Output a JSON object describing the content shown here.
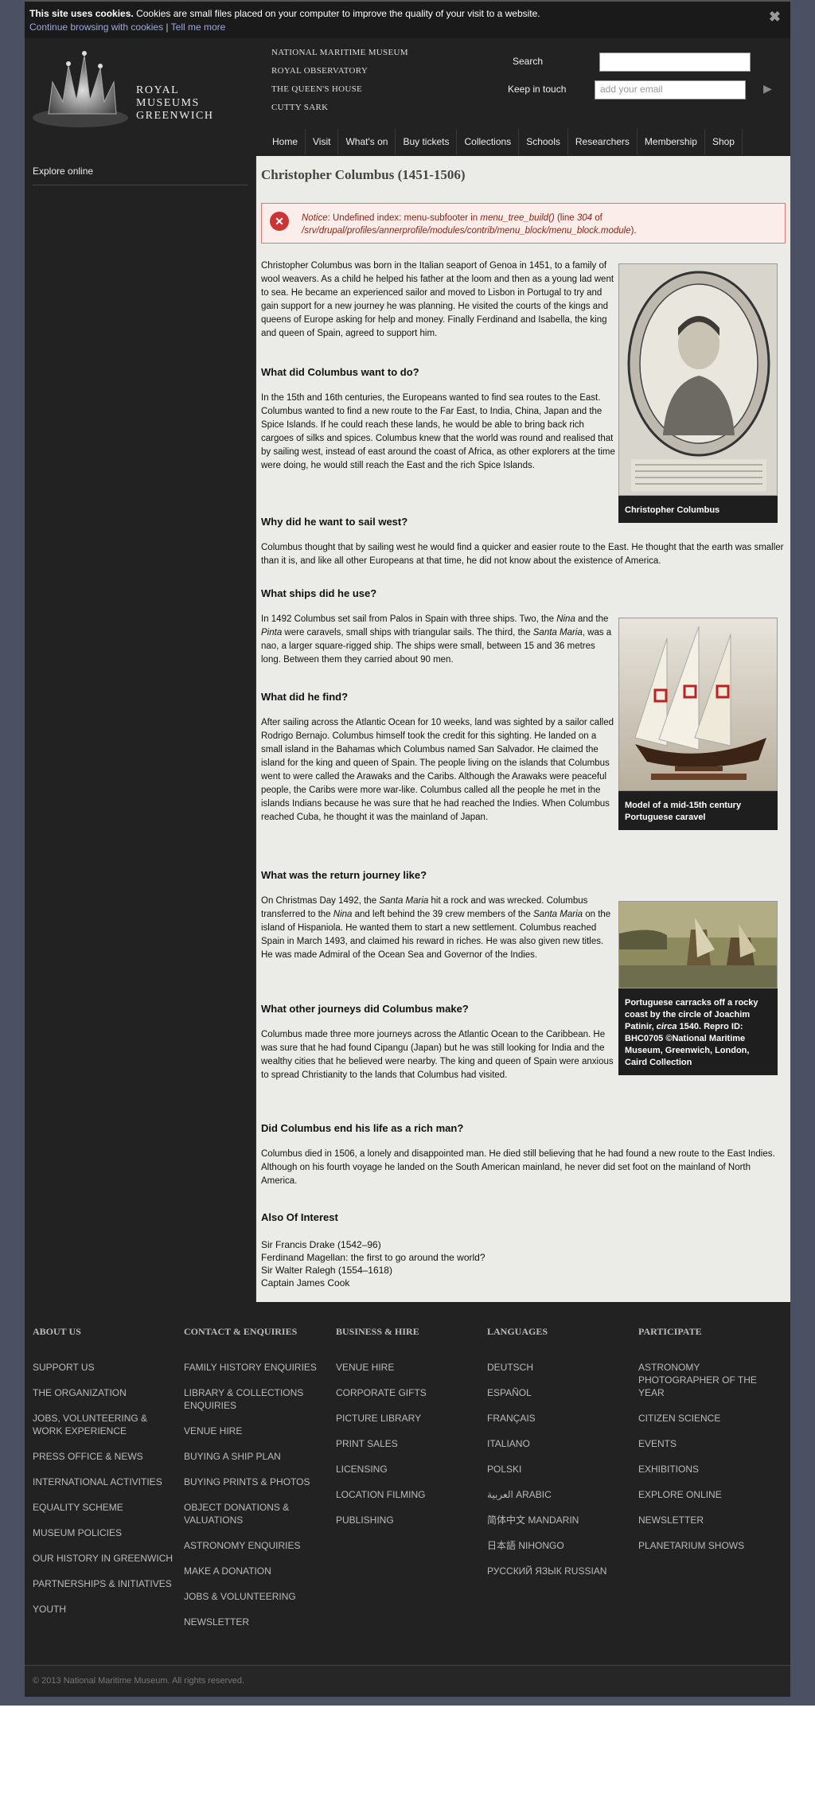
{
  "cookie": {
    "bold": "This site uses cookies.",
    "text": " Cookies are small files placed on your computer to improve the quality of your visit to a website.",
    "continue": "Continue browsing with cookies",
    "sep": " | ",
    "tell": "Tell me more",
    "close": "✖"
  },
  "brand": {
    "line1": "ROYAL",
    "line2": "MUSEUMS",
    "line3": "GREENWICH"
  },
  "sites": [
    "NATIONAL MARITIME MUSEUM",
    "ROYAL OBSERVATORY",
    "THE QUEEN'S HOUSE",
    "CUTTY SARK"
  ],
  "search": {
    "label": "Search"
  },
  "touch": {
    "label": "Keep in touch",
    "placeholder": "add your email",
    "go": "▶"
  },
  "nav": [
    "Home",
    "Visit",
    "What's on",
    "Buy tickets",
    "Collections",
    "Schools",
    "Researchers",
    "Membership",
    "Shop"
  ],
  "sidebar": {
    "item": "Explore online"
  },
  "page": {
    "title": "Christopher Columbus (1451-1506)"
  },
  "notice": {
    "label": "Notice",
    "text1": ": Undefined index: menu-subfooter in ",
    "func": "menu_tree_build()",
    "text2": " (line ",
    "line": "304",
    "text3": " of ",
    "path": "/srv/drupal/profiles/annerprofile/modules/contrib/menu_block/menu_block.module",
    "text4": ")."
  },
  "body": {
    "p1": "Christopher Columbus was born in the Italian seaport of Genoa in 1451, to a family of wool weavers. As a child he helped his father at the loom and then as a young lad went to sea. He became an experienced sailor and moved to Lisbon in Portugal to try and gain support for a new journey he was planning. He visited the courts of the kings and queens of Europe asking for help and money. Finally Ferdinand and Isabella, the king and queen of Spain, agreed to support him.",
    "h1": "What did Columbus want to do?",
    "p2": "In the 15th and 16th centuries, the Europeans wanted to find sea routes to the East. Columbus wanted to find a new route to the Far East, to India, China, Japan and the Spice Islands. If he could reach these lands, he would be able to bring back rich cargoes of silks and spices. Columbus knew that the world was round and realised that by sailing west, instead of east around the coast of Africa, as other explorers at the time were doing, he would still reach the East and the rich Spice Islands.",
    "h2": "Why did he want to sail west?",
    "p3": "Columbus thought that by sailing west he would find a quicker and easier route to the East. He thought that the earth was smaller than it is, and like all other Europeans at that time, he did not know about the existence of America.",
    "h3": "What ships did he use?",
    "p4a": "In 1492 Columbus set sail from Palos in Spain with three ships. Two, the ",
    "p4b": "Nina",
    "p4c": " and the ",
    "p4d": "Pinta",
    "p4e": " were caravels, small ships with triangular sails. The third, the ",
    "p4f": "Santa Maria",
    "p4g": ", was a nao, a larger square-rigged ship. The ships were small, between 15 and 36 metres long. Between them they carried about 90 men.",
    "h4": "What did he find?",
    "p5": "After sailing across the Atlantic Ocean for 10 weeks, land was sighted by a sailor called Rodrigo Bernajo. Columbus himself took the credit for this sighting. He landed on a small island in the Bahamas which Columbus named San Salvador. He claimed the island for the king and queen of Spain. The people living on the islands that Columbus went to were called the Arawaks and the Caribs. Although the Arawaks were peaceful people, the Caribs were more war-like. Columbus called all the people he met in the islands Indians because he was sure that he had reached the Indies. When Columbus reached Cuba, he thought it was the mainland of Japan.",
    "h5": "What was the return journey like?",
    "p6a": "On Christmas Day 1492, the ",
    "p6b": "Santa Maria",
    "p6c": " hit a rock and was wrecked. Columbus transferred to the ",
    "p6d": "Nina",
    "p6e": " and left behind the 39 crew members of the ",
    "p6f": "Santa Maria",
    "p6g": " on the island of Hispaniola. He wanted them to start a new settlement. Columbus reached Spain in March 1493, and claimed his reward in riches. He was also given new titles. He was made Admiral of the Ocean Sea and Governor of the Indies.",
    "h6": "What other journeys did Columbus make?",
    "p7": "Columbus made three more journeys across the Atlantic Ocean to the Caribbean. He was sure that he had found Cipangu (Japan) but he was still looking for India and the wealthy cities that he believed were nearby. The king and queen of Spain were anxious to spread Christianity to the lands that Columbus had visited.",
    "h7": "Did Columbus end his life as a rich man?",
    "p8": "Columbus died in 1506, a lonely and disappointed man. He died still believing that he had found a new route to the East Indies. Although on his fourth voyage he landed on the South American mainland, he never did set foot on the mainland of North America.",
    "h8": "Also Of Interest",
    "also": [
      "Sir Francis Drake (1542–96)",
      "Ferdinand Magellan: the first to go around the world?",
      "Sir Walter Ralegh (1554–1618)",
      "Captain James Cook"
    ]
  },
  "figs": {
    "f1": "Christopher Columbus",
    "f2": "Model of a mid-15th century Portuguese caravel",
    "f3a": "Portuguese carracks off a rocky coast by the circle of Joachim Patinir, ",
    "f3b": "circa",
    "f3c": " 1540. Repro ID: BHC0705 ©National Maritime Museum, Greenwich, London, Caird Collection"
  },
  "footer": {
    "cols": [
      {
        "title": "ABOUT US",
        "links": [
          "SUPPORT US",
          "THE ORGANIZATION",
          "JOBS, VOLUNTEERING & WORK EXPERIENCE",
          "PRESS OFFICE & NEWS",
          "INTERNATIONAL ACTIVITIES",
          "EQUALITY SCHEME",
          "MUSEUM POLICIES",
          "OUR HISTORY IN GREENWICH",
          "PARTNERSHIPS & INITIATIVES",
          "YOUTH"
        ]
      },
      {
        "title": "CONTACT & ENQUIRIES",
        "links": [
          "FAMILY HISTORY ENQUIRIES",
          "LIBRARY & COLLECTIONS ENQUIRIES",
          "VENUE HIRE",
          "BUYING A SHIP PLAN",
          "BUYING PRINTS & PHOTOS",
          "OBJECT DONATIONS & VALUATIONS",
          "ASTRONOMY ENQUIRIES",
          "MAKE A DONATION",
          "JOBS & VOLUNTEERING",
          "NEWSLETTER"
        ]
      },
      {
        "title": "BUSINESS & HIRE",
        "links": [
          "VENUE HIRE",
          "CORPORATE GIFTS",
          "PICTURE LIBRARY",
          "PRINT SALES",
          "LICENSING",
          "LOCATION FILMING",
          "PUBLISHING"
        ]
      },
      {
        "title": "LANGUAGES",
        "links": [
          "DEUTSCH",
          "ESPAÑOL",
          "FRANÇAIS",
          "ITALIANO",
          "POLSKI",
          "العربية ARABIC",
          "简体中文 MANDARIN",
          "日本語 NIHONGO",
          "РУССКИЙ ЯЗЫК RUSSIAN"
        ]
      },
      {
        "title": "PARTICIPATE",
        "links": [
          "ASTRONOMY PHOTOGRAPHER OF THE YEAR",
          "CITIZEN SCIENCE",
          "EVENTS",
          "EXHIBITIONS",
          "EXPLORE ONLINE",
          "NEWSLETTER",
          "PLANETARIUM SHOWS"
        ]
      }
    ],
    "copyright": "© 2013 National Maritime Museum. All rights reserved."
  },
  "colors": {
    "page_bg": "#4b5163",
    "header_bg": "#222222",
    "content_bg": "#ebebe7",
    "notice_border": "#dd7777"
  }
}
